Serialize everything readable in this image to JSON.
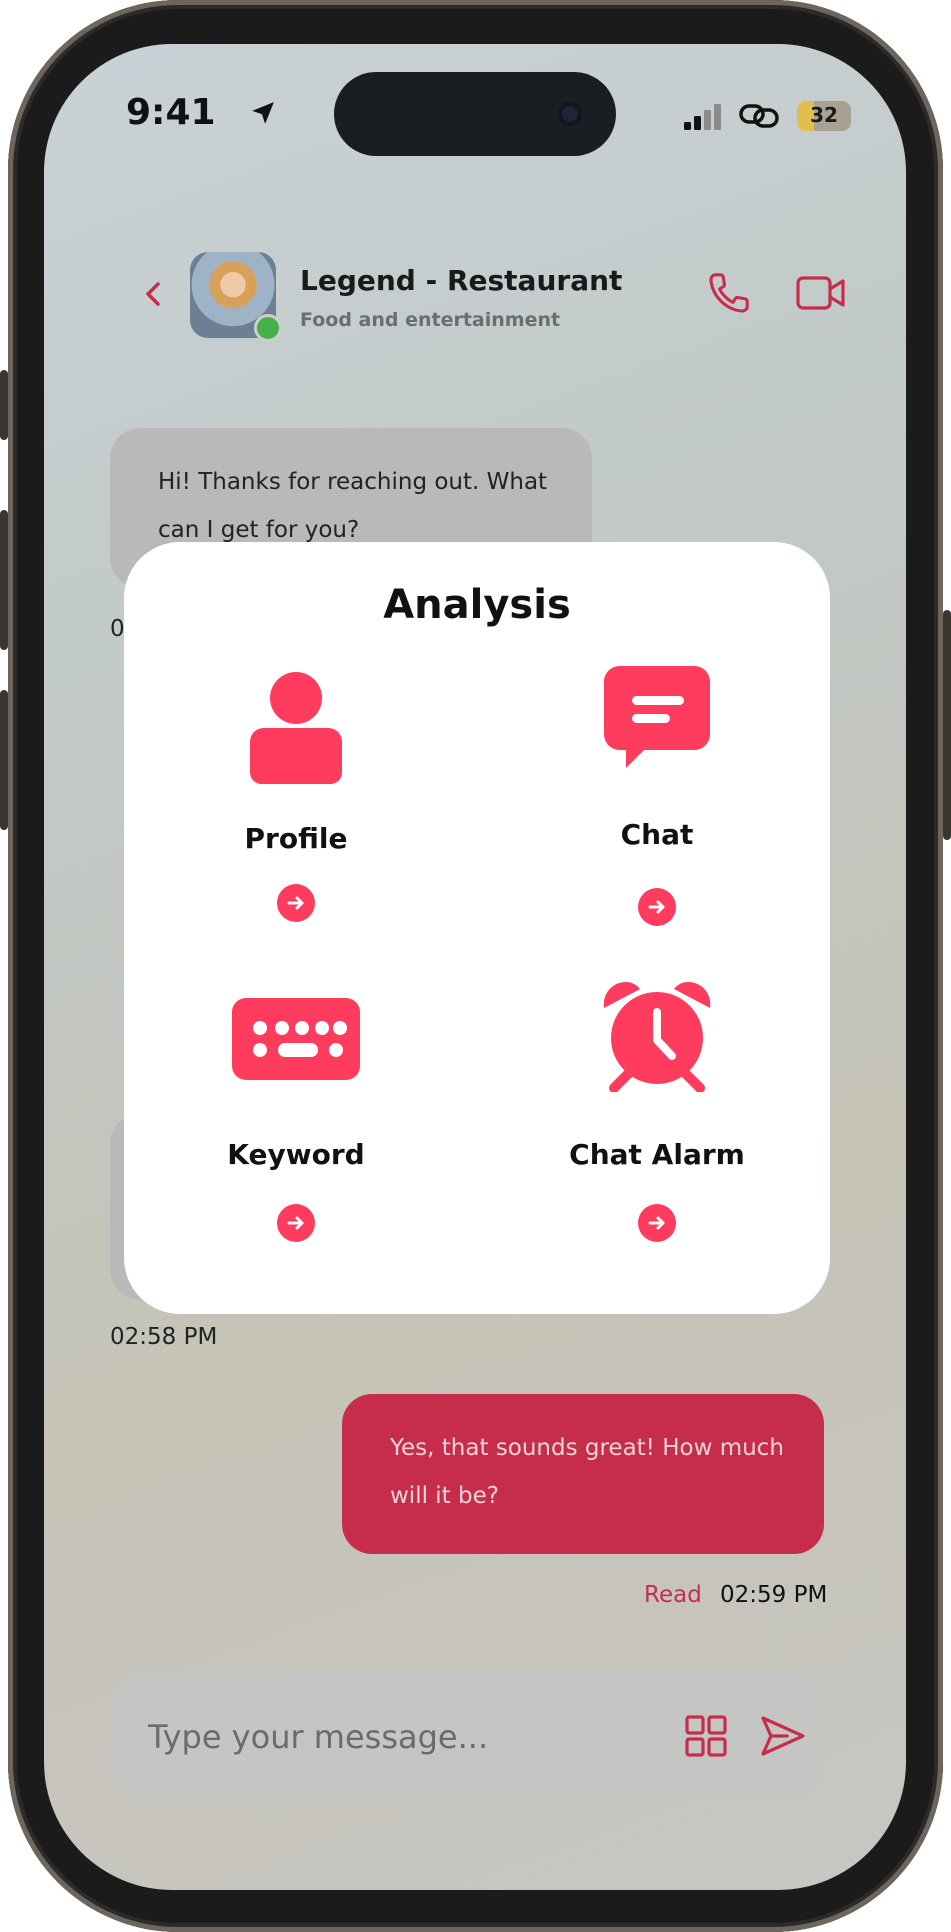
{
  "status_bar": {
    "time": "9:41",
    "battery_level": "32",
    "icons": [
      "location-arrow-icon",
      "signal-bars-icon",
      "link-icon",
      "battery-icon"
    ]
  },
  "header": {
    "contact_name": "Legend - Restaurant",
    "contact_subtitle": "Food and entertainment",
    "online": true,
    "icons": [
      "chevron-left-icon",
      "phone-icon",
      "video-camera-icon"
    ]
  },
  "messages": [
    {
      "direction": "incoming",
      "text": "Hi! Thanks for reaching out. What can I get for you?",
      "time": "0"
    },
    {
      "direction": "incoming",
      "text": "",
      "time": "02:58 PM"
    },
    {
      "direction": "outgoing",
      "text": "Yes, that sounds great! How much will it be?",
      "status": "Read",
      "time": "02:59 PM"
    }
  ],
  "composer": {
    "placeholder": "Type your message...",
    "icons": [
      "grid-icon",
      "send-icon"
    ]
  },
  "modal": {
    "title": "Analysis",
    "items": [
      {
        "label": "Profile",
        "icon": "user-icon"
      },
      {
        "label": "Chat",
        "icon": "chat-bubble-icon"
      },
      {
        "label": "Keyword",
        "icon": "keyboard-icon"
      },
      {
        "label": "Chat Alarm",
        "icon": "alarm-clock-icon"
      }
    ]
  },
  "colors": {
    "accent": "#ff3b5e",
    "outgoing_bubble": "#c62d4a",
    "incoming_bubble": "#b9b9b9",
    "online": "#47b04a"
  }
}
